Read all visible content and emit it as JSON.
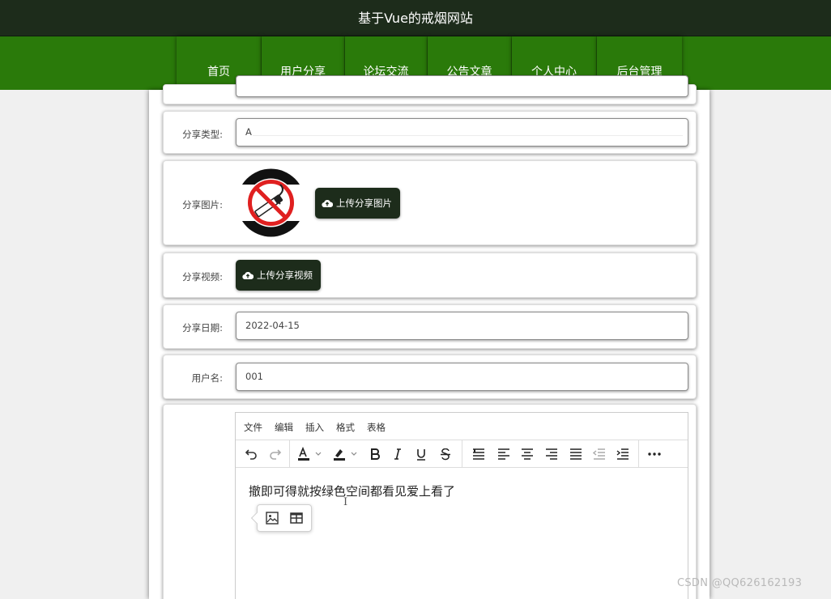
{
  "header": {
    "title": "基于Vue的戒烟网站"
  },
  "nav": [
    {
      "label": "首页"
    },
    {
      "label": "用户分享"
    },
    {
      "label": "论坛交流"
    },
    {
      "label": "公告文章"
    },
    {
      "label": "个人中心"
    },
    {
      "label": "后台管理"
    }
  ],
  "form": {
    "share_type": {
      "label": "分享类型:",
      "value": "A"
    },
    "share_image": {
      "label": "分享图片:",
      "button": "上传分享图片"
    },
    "share_video": {
      "label": "分享视频:",
      "button": "上传分享视频"
    },
    "share_date": {
      "label": "分享日期:",
      "value": "2022-04-15"
    },
    "username": {
      "label": "用户名:",
      "value": "001"
    }
  },
  "editor": {
    "menu": [
      "文件",
      "编辑",
      "插入",
      "格式",
      "表格"
    ],
    "content": "撤即可得就按绿色空间都看见爱上看了"
  },
  "watermark": "CSDN @QQ626162193",
  "colors": {
    "header_bg": "#1d2c1b",
    "nav_bg": "#2a7a0a",
    "button_bg": "#1d2c1b"
  }
}
